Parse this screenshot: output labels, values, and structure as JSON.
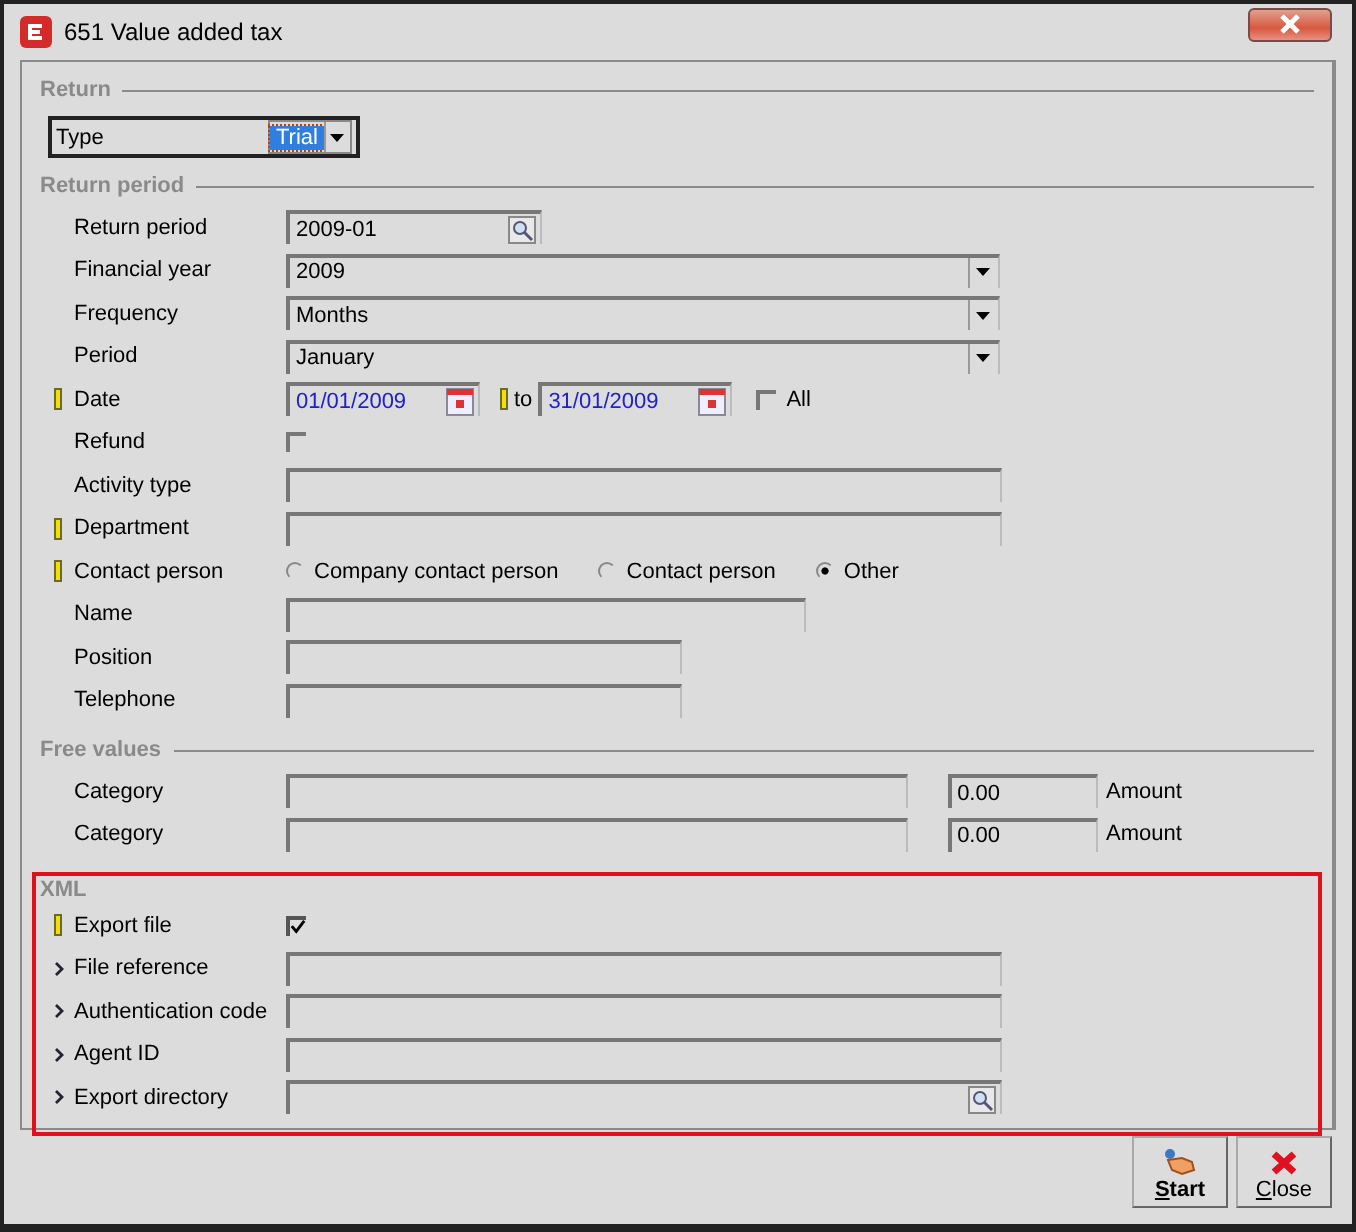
{
  "window": {
    "title": "651 Value added tax"
  },
  "sections": [
    {
      "title": "Return",
      "highlighted": false,
      "rows": [
        {
          "kind": "type-select",
          "label": "Type",
          "value": "Trial"
        }
      ]
    },
    {
      "title": "Return period",
      "highlighted": false,
      "rows": [
        {
          "kind": "lookup",
          "required": false,
          "label": "Return period",
          "value": "2009-01"
        },
        {
          "kind": "select",
          "required": false,
          "label": "Financial year",
          "value": "2009"
        },
        {
          "kind": "select",
          "required": false,
          "label": "Frequency",
          "value": "Months"
        },
        {
          "kind": "select",
          "required": false,
          "label": "Period",
          "value": "January"
        },
        {
          "kind": "date-range",
          "required": true,
          "label": "Date",
          "from": "01/01/2009",
          "to_required": true,
          "to_label": "to",
          "to": "31/01/2009",
          "all_label": "All",
          "all_checked": false
        },
        {
          "kind": "checkbox",
          "required": false,
          "label": "Refund",
          "checked": false
        },
        {
          "kind": "text",
          "required": false,
          "label": "Activity type"
        },
        {
          "kind": "text",
          "required": true,
          "label": "Department"
        },
        {
          "kind": "radio",
          "required": true,
          "label": "Contact person",
          "options": [
            {
              "label": "Company contact person",
              "selected": false
            },
            {
              "label": "Contact person",
              "selected": false
            },
            {
              "label": "Other",
              "selected": true
            }
          ]
        },
        {
          "kind": "text-medium",
          "required": false,
          "label": "Name"
        },
        {
          "kind": "text-small",
          "required": false,
          "label": "Position"
        },
        {
          "kind": "text-small",
          "required": false,
          "label": "Telephone"
        }
      ]
    },
    {
      "title": "Free values",
      "highlighted": false,
      "rows": [
        {
          "kind": "category",
          "required": false,
          "label": "Category",
          "amount": "0.00",
          "amount_label": "Amount"
        },
        {
          "kind": "category",
          "required": false,
          "label": "Category",
          "amount": "0.00",
          "amount_label": "Amount"
        }
      ]
    },
    {
      "title": "XML",
      "highlighted": true,
      "rows": [
        {
          "kind": "checkbox",
          "required": true,
          "chevron": false,
          "label": "Export file",
          "checked": true
        },
        {
          "kind": "text",
          "required": false,
          "chevron": true,
          "label": "File reference"
        },
        {
          "kind": "text",
          "required": false,
          "chevron": true,
          "label": "Authentication code"
        },
        {
          "kind": "text",
          "required": false,
          "chevron": true,
          "label": "Agent ID"
        },
        {
          "kind": "browse",
          "required": false,
          "chevron": true,
          "label": "Export directory"
        }
      ]
    }
  ],
  "buttons": [
    {
      "kind": "start",
      "label": "Start"
    },
    {
      "kind": "close",
      "label": "Close"
    }
  ]
}
